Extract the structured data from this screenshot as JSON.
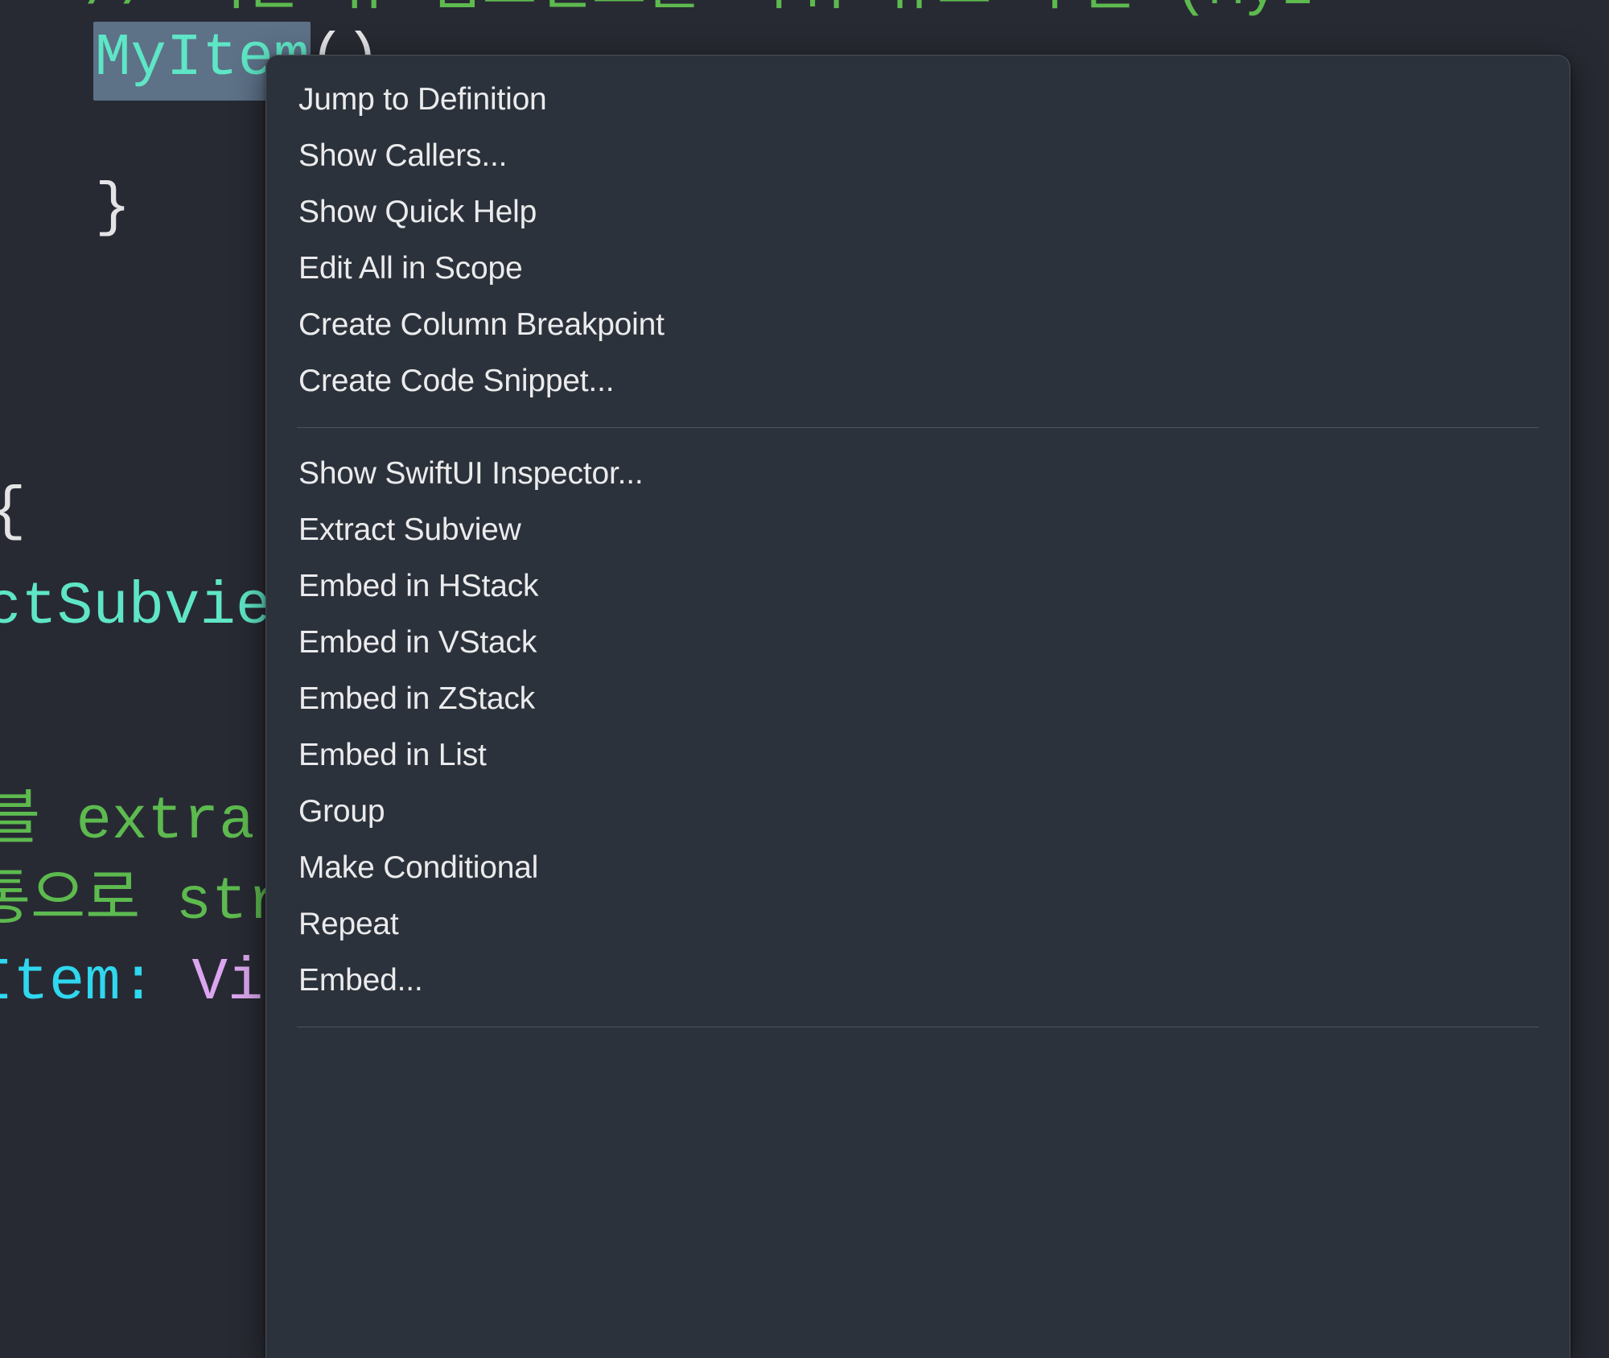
{
  "app": {
    "window_kind": "code-editor-with-context-menu",
    "colors": {
      "editor_background": "#282a33",
      "menu_background": "#2c323b",
      "menu_border": "#4a4f58",
      "menu_text": "#ebebed",
      "separator": "#4d525b",
      "selection_highlight": "#5d7187",
      "type_token": "#5ee6c6",
      "comment_token": "#5dba4f",
      "cyan_token": "#2fd7ef",
      "pink_token": "#dba6ef",
      "plain_token": "#e4e4e6"
    }
  },
  "editor": {
    "lines": [
      {
        "id": "line-comment-top",
        "text": "// 기존 뷰 컴포넌트를 하위 뷰로 추출 (MyI",
        "style": "tok-comment"
      },
      {
        "id": "line-myitem",
        "text": "MyItem",
        "suffix": "()",
        "style": "tok-type",
        "selected": true
      },
      {
        "id": "line-close-brace",
        "text": "}",
        "style": "tok-plain"
      },
      {
        "id": "line-open-brace",
        "text": "{",
        "style": "tok-plain"
      },
      {
        "id": "line-ctsubview",
        "text": "ctSubvie",
        "style": "tok-type"
      },
      {
        "id": "line-comment-extract",
        "text": "블 extra",
        "style": "tok-comment"
      },
      {
        "id": "line-comment-korean",
        "text": "통으로 str",
        "style": "tok-comment"
      },
      {
        "id": "line-struct-decl-a",
        "text": "Item: ",
        "style": "tok-cyan"
      },
      {
        "id": "line-struct-decl-b",
        "text": "Vi",
        "style": "tok-pink"
      }
    ]
  },
  "context_menu": {
    "name": "Xcode editor context menu",
    "groups": [
      {
        "id": "group-navigation",
        "items": [
          {
            "id": "jump-to-definition",
            "label": "Jump to Definition"
          },
          {
            "id": "show-callers",
            "label": "Show Callers..."
          },
          {
            "id": "show-quick-help",
            "label": "Show Quick Help"
          },
          {
            "id": "edit-all-in-scope",
            "label": "Edit All in Scope"
          },
          {
            "id": "create-column-breakpoint",
            "label": "Create Column Breakpoint"
          },
          {
            "id": "create-code-snippet",
            "label": "Create Code Snippet..."
          }
        ]
      },
      {
        "id": "group-swiftui",
        "items": [
          {
            "id": "show-swiftui-inspector",
            "label": "Show SwiftUI Inspector..."
          },
          {
            "id": "extract-subview",
            "label": "Extract Subview"
          },
          {
            "id": "embed-in-hstack",
            "label": "Embed in HStack"
          },
          {
            "id": "embed-in-vstack",
            "label": "Embed in VStack"
          },
          {
            "id": "embed-in-zstack",
            "label": "Embed in ZStack"
          },
          {
            "id": "embed-in-list",
            "label": "Embed in List"
          },
          {
            "id": "group",
            "label": "Group"
          },
          {
            "id": "make-conditional",
            "label": "Make Conditional"
          },
          {
            "id": "repeat",
            "label": "Repeat"
          },
          {
            "id": "embed",
            "label": "Embed..."
          }
        ]
      }
    ]
  }
}
